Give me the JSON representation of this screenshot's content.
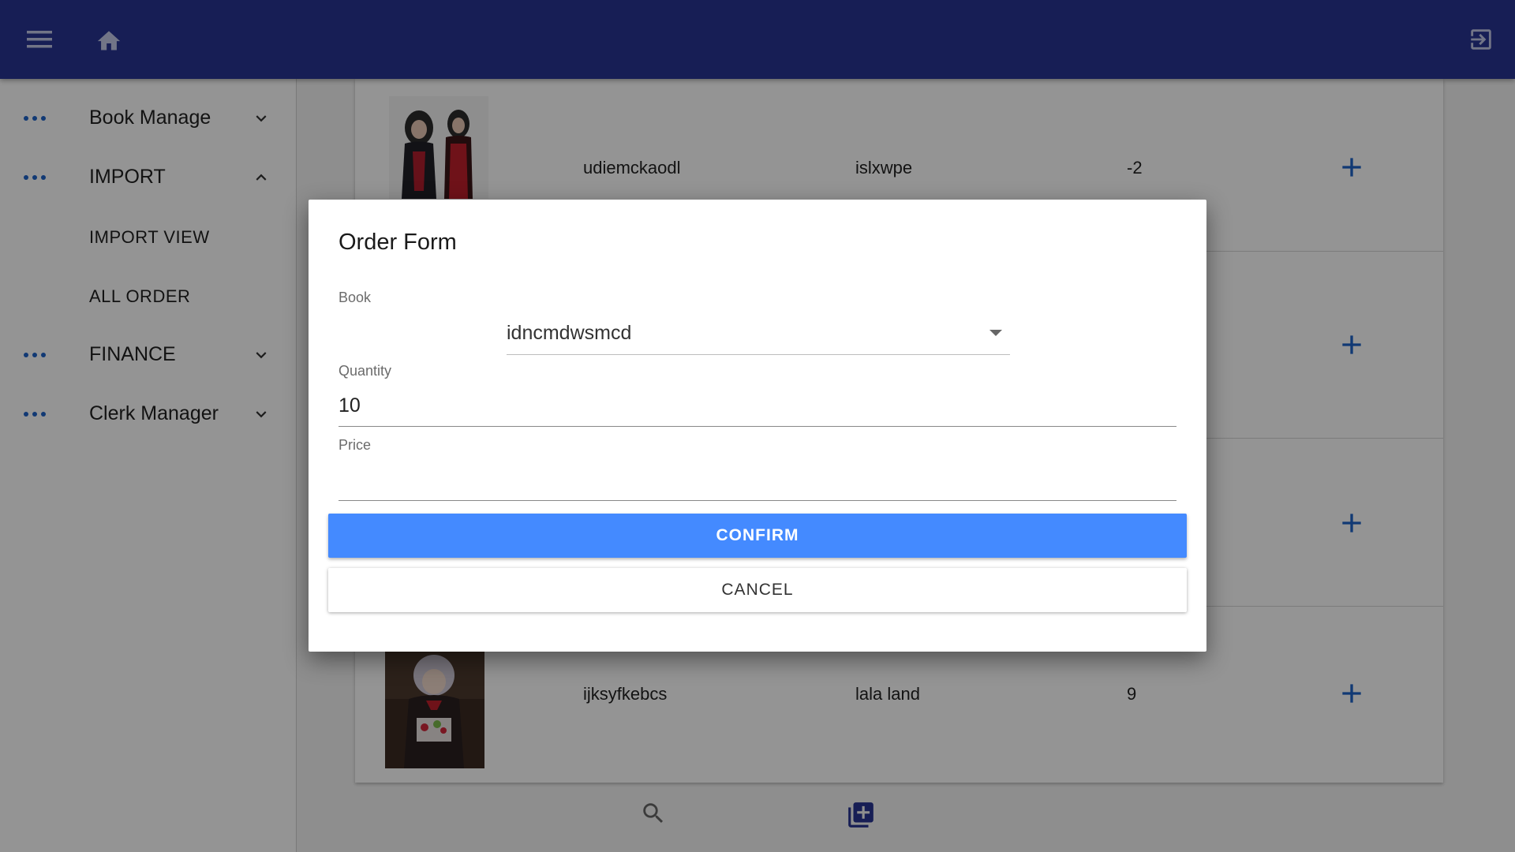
{
  "appbar": {
    "bg_color": "#283593",
    "menu_icon": "menu-icon",
    "home_icon": "home-icon",
    "logout_icon": "exit-to-app-icon"
  },
  "sidebar": {
    "items": [
      {
        "label": "Book Manage",
        "expanded": false
      },
      {
        "label": "IMPORT",
        "expanded": true,
        "children": [
          {
            "label": "IMPORT VIEW"
          },
          {
            "label": "ALL ORDER"
          }
        ]
      },
      {
        "label": "FINANCE",
        "expanded": false
      },
      {
        "label": "Clerk Manager",
        "expanded": false
      }
    ]
  },
  "table": {
    "rows": [
      {
        "name": "udiemckaodl",
        "publisher": "islxwpe",
        "quantity": "-2"
      },
      {
        "name": "",
        "publisher": "",
        "quantity": ""
      },
      {
        "name": "",
        "publisher": "",
        "quantity": ""
      },
      {
        "name": "ijksyfkebcs",
        "publisher": "lala land",
        "quantity": "9"
      }
    ],
    "add_icon": "plus-icon"
  },
  "bottom_bar": {
    "search_icon": "search-icon",
    "add_library_icon": "library-add-icon"
  },
  "dialog": {
    "title": "Order Form",
    "book_label": "Book",
    "book_value": "idncmdwsmcd",
    "quantity_label": "Quantity",
    "quantity_value": "10",
    "price_label": "Price",
    "price_value": "",
    "confirm_label": "CONFIRM",
    "cancel_label": "CANCEL",
    "accent": "#448aff"
  }
}
